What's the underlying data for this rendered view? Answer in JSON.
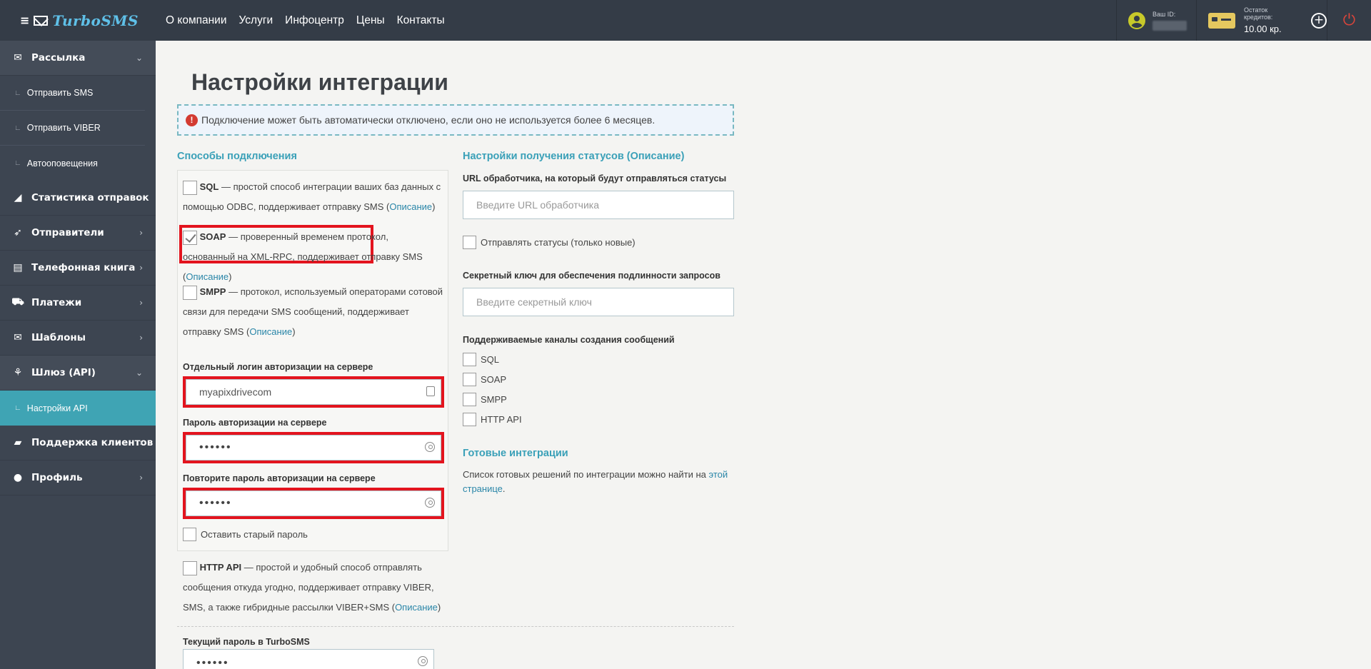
{
  "header": {
    "brand": "TurboSMS",
    "nav": [
      "О компании",
      "Услуги",
      "Инфоцентр",
      "Цены",
      "Контакты"
    ],
    "user_id_label": "Ваш ID:",
    "credits_label": "Остаток кредитов:",
    "credits_value": "10.00 кр."
  },
  "sidebar": {
    "items": [
      {
        "label": "Рассылка",
        "icon": "envelope-icon",
        "chev": "⌄"
      },
      {
        "label": "Статистика отправок",
        "icon": "chart-icon",
        "chev": "›"
      },
      {
        "label": "Отправители",
        "icon": "rocket-icon",
        "chev": "›"
      },
      {
        "label": "Телефонная книга",
        "icon": "contacts-icon",
        "chev": "›"
      },
      {
        "label": "Платежи",
        "icon": "cart-icon",
        "chev": "›"
      },
      {
        "label": "Шаблоны",
        "icon": "envelope-icon",
        "chev": "›"
      },
      {
        "label": "Шлюз (API)",
        "icon": "sitemap-icon",
        "chev": "⌄"
      },
      {
        "label": "Поддержка клиентов",
        "icon": "chat-icon",
        "chev": "›"
      },
      {
        "label": "Профиль",
        "icon": "user-icon",
        "chev": "›"
      }
    ],
    "subitems_mailing": [
      "Отправить SMS",
      "Отправить VIBER",
      "Автооповещения"
    ],
    "subitems_api": [
      "Настройки API"
    ]
  },
  "page": {
    "title": "Настройки интеграции",
    "notice": "Подключение может быть автоматически отключено, если оно не используется более 6 месяцев."
  },
  "methods": {
    "title": "Способы подключения",
    "sql": {
      "name": "SQL",
      "desc": " — простой способ интеграции ваших баз данных с",
      "desc2": "помощью ODBC, поддерживает отправку SMS (",
      "link": "Описание",
      "end": ")"
    },
    "soap": {
      "name": "SOAP",
      "desc": " — проверенный временем протокол,",
      "desc2": "основанный на XML-RPC, поддерживает отправку SMS",
      "desc3": "(",
      "link": "Описание",
      "end": ")"
    },
    "smpp": {
      "name": "SMPP",
      "desc": " — протокол, используемый операторами сотовой",
      "desc2": "связи для передачи SMS сообщений, поддерживает",
      "desc3": "отправку SMS (",
      "link": "Описание",
      "end": ")"
    },
    "login_label": "Отдельный логин авторизации на сервере",
    "login_value": "myapixdrivecom",
    "password_label": "Пароль авторизации на сервере",
    "password_value": "••••••",
    "password2_label": "Повторите пароль авторизации на сервере",
    "password2_value": "••••••",
    "keep_old": "Оставить старый пароль",
    "http": {
      "name": "HTTP API",
      "desc": " — простой и удобный способ отправлять",
      "desc2": "сообщения откуда угодно, поддерживает отправку VIBER,",
      "desc3": "SMS, а также гибридные рассылки VIBER+SMS (",
      "link": "Описание",
      "end": ")"
    },
    "current_pw_label": "Текущий пароль в TurboSMS",
    "current_pw_value": "••••••"
  },
  "status": {
    "title": "Настройки получения статусов (Описание)",
    "url_label": "URL обработчика, на который будут отправляться статусы",
    "url_placeholder": "Введите URL обработчика",
    "send_statuses": "Отправлять статусы (только новые)",
    "secret_label": "Секретный ключ для обеспечения подлинности запросов",
    "secret_placeholder": "Введите секретный ключ",
    "channels_label": "Поддерживаемые каналы создания сообщений",
    "channels": [
      "SQL",
      "SOAP",
      "SMPP",
      "HTTP API"
    ]
  },
  "ready": {
    "title": "Готовые интеграции",
    "text": "Список готовых решений по интеграции можно найти на ",
    "link1": "этой",
    "link2": "странице",
    "end": "."
  }
}
